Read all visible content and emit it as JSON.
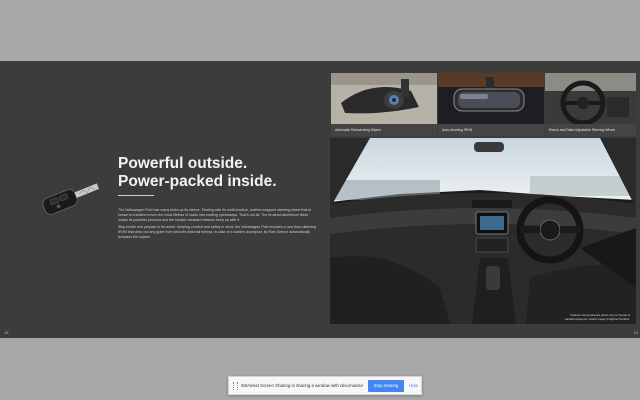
{
  "brochure": {
    "headline_line1": "Powerful outside.",
    "headline_line2": "Power-packed inside.",
    "body_paragraphs": [
      "The Volkswagen Polo has many tricks up its sleeve. Starting with its multi-function, leather-wrapped steering wheel that is known to transform even the most lifeless of roads into exciting speedways. That's not all. The brushed aluminium finish marks its powerful persona and the scratch-resistant interiors keep up with it.",
      "Step inside and prepare to be awed. Keeping comfort and safety in mind, the Volkswagen Polo includes a new Auto-dimming IRVM that dims out any glare from vehicles that trail behind, in case of a sudden downpour, its Rain Sensor automatically activates the wipers."
    ],
    "page_left": "18",
    "page_right": "19",
    "thumbnails": [
      {
        "caption": "Automatic Rainsensing Wipers",
        "icon": "rain-sensor-photo"
      },
      {
        "caption": "Auto-dimming IRVM",
        "icon": "mirror-photo"
      },
      {
        "caption": "Reach and Rake Adjustable Steering Wheel",
        "icon": "steering-wheel-photo"
      }
    ],
    "main_photo_label": "interior-dashboard-photo",
    "disclaimer": "Features and accessories shown may not be part of standard equipment. Interior image of Highline/Trendline."
  },
  "share_bar": {
    "message": "IMIAssist Screen Sharing is sharing a window with dev.imiassist.ai",
    "stop_label": "Stop sharing",
    "hide_label": "Hide"
  },
  "colors": {
    "page_bg": "#a8a8a8",
    "spread_bg": "#3c3c3c",
    "accent": "#4285f4"
  }
}
